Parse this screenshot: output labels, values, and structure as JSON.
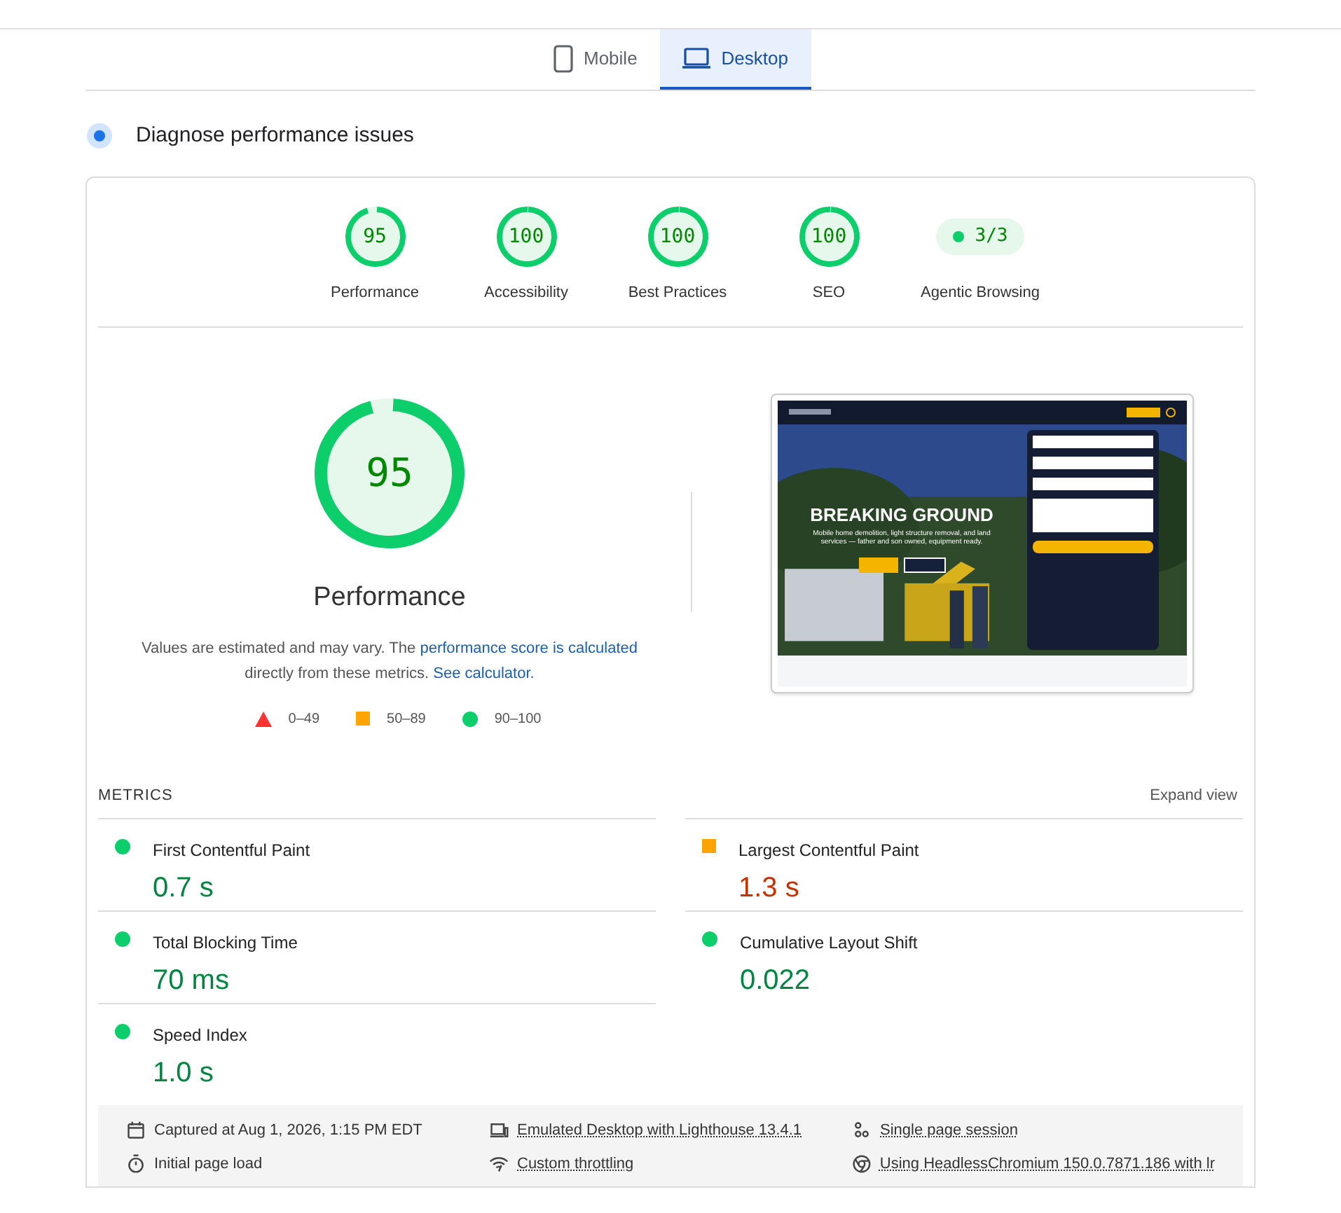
{
  "device_tabs": [
    {
      "label": "Mobile",
      "kind": "phone",
      "selected": false
    },
    {
      "label": "Desktop",
      "kind": "laptop",
      "selected": true
    }
  ],
  "section_title": "Diagnose performance issues",
  "categories": [
    {
      "kind": "gauge",
      "score": "95",
      "label": "Performance",
      "level": 0.95
    },
    {
      "kind": "gauge",
      "score": "100",
      "label": "Accessibility",
      "level": 1
    },
    {
      "kind": "gauge",
      "score": "100",
      "label": "Best Practices",
      "level": 1
    },
    {
      "kind": "gauge",
      "score": "100",
      "label": "SEO",
      "level": 1
    },
    {
      "kind": "pill",
      "score": "3/3",
      "label": "Agentic Browsing"
    }
  ],
  "main_score": {
    "score": "95",
    "label": "Performance",
    "level": 0.95
  },
  "note": {
    "text": "Values are estimated and may vary. The ",
    "link1": "performance score is calculated",
    "middle": "directly from these metrics.",
    "link2": "See calculator."
  },
  "legend": [
    {
      "kind": "fail",
      "range": "0–49"
    },
    {
      "kind": "average",
      "range": "50–89"
    },
    {
      "kind": "pass",
      "range": "90–100"
    }
  ],
  "preview": {
    "headline": "BREAKING GROUND",
    "subtitle": "Mobile home demolition, light structure removal, and land services — father and son owned, equipment ready."
  },
  "metrics_heading": "METRICS",
  "expand": "Expand view",
  "metrics": [
    {
      "name": "First Contentful Paint",
      "value": "0.7 s",
      "kind": "pass"
    },
    {
      "name": "Largest Contentful Paint",
      "value": "1.3 s",
      "kind": "average"
    },
    {
      "name": "Total Blocking Time",
      "value": "70 ms",
      "kind": "pass"
    },
    {
      "name": "Cumulative Layout Shift",
      "value": "0.022",
      "kind": "pass"
    },
    {
      "name": "Speed Index",
      "value": "1.0 s",
      "kind": "pass"
    }
  ],
  "footer": [
    {
      "kind": "calendar",
      "text": "Captured at Aug 1, 2026, 1:15 PM EDT",
      "link": false
    },
    {
      "kind": "laptop",
      "text": "Emulated Desktop with Lighthouse 13.4.1",
      "link": true
    },
    {
      "kind": "people",
      "text": "Single page session",
      "link": true
    },
    {
      "kind": "timer",
      "text": "Initial page load",
      "link": false
    },
    {
      "kind": "signal",
      "text": "Custom throttling",
      "link": true
    },
    {
      "kind": "browser",
      "text": "Using HeadlessChromium 150.0.7871.186 with lr",
      "link": true
    }
  ]
}
